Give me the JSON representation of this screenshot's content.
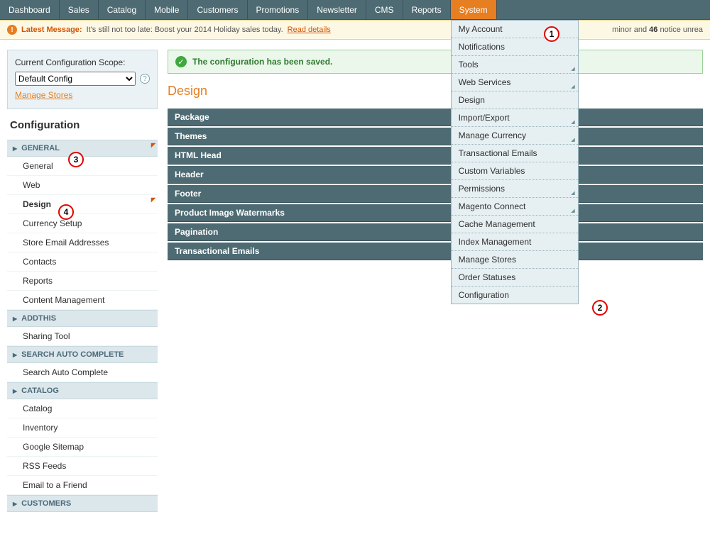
{
  "topnav": {
    "items": [
      {
        "label": "Dashboard"
      },
      {
        "label": "Sales"
      },
      {
        "label": "Catalog"
      },
      {
        "label": "Mobile"
      },
      {
        "label": "Customers"
      },
      {
        "label": "Promotions"
      },
      {
        "label": "Newsletter"
      },
      {
        "label": "CMS"
      },
      {
        "label": "Reports"
      },
      {
        "label": "System"
      }
    ],
    "dropdown": {
      "items": [
        {
          "label": "My Account",
          "expand": false
        },
        {
          "label": "Notifications",
          "expand": false
        },
        {
          "label": "Tools",
          "expand": true
        },
        {
          "label": "Web Services",
          "expand": true
        },
        {
          "label": "Design",
          "expand": false
        },
        {
          "label": "Import/Export",
          "expand": true
        },
        {
          "label": "Manage Currency",
          "expand": true
        },
        {
          "label": "Transactional Emails",
          "expand": false
        },
        {
          "label": "Custom Variables",
          "expand": false
        },
        {
          "label": "Permissions",
          "expand": true
        },
        {
          "label": "Magento Connect",
          "expand": true
        },
        {
          "label": "Cache Management",
          "expand": false
        },
        {
          "label": "Index Management",
          "expand": false
        },
        {
          "label": "Manage Stores",
          "expand": false
        },
        {
          "label": "Order Statuses",
          "expand": false
        },
        {
          "label": "Configuration",
          "expand": false
        }
      ]
    }
  },
  "msgbar": {
    "prefix": "Latest Message:",
    "text": "It's still not too late: Boost your 2014 Holiday sales today.",
    "link": "Read details",
    "right_minor": "minor and",
    "right_count": "46",
    "right_rest": "notice unrea"
  },
  "scope": {
    "label": "Current Configuration Scope:",
    "selected": "Default Config",
    "manage": "Manage Stores"
  },
  "conf_title": "Configuration",
  "sections": [
    {
      "head": "GENERAL",
      "marker": true,
      "items": [
        {
          "label": "General"
        },
        {
          "label": "Web"
        },
        {
          "label": "Design",
          "active": true,
          "marker": true
        },
        {
          "label": "Currency Setup"
        },
        {
          "label": "Store Email Addresses"
        },
        {
          "label": "Contacts"
        },
        {
          "label": "Reports"
        },
        {
          "label": "Content Management"
        }
      ]
    },
    {
      "head": "ADDTHIS",
      "items": [
        {
          "label": "Sharing Tool"
        }
      ]
    },
    {
      "head": "SEARCH AUTO COMPLETE",
      "items": [
        {
          "label": "Search Auto Complete"
        }
      ]
    },
    {
      "head": "CATALOG",
      "items": [
        {
          "label": "Catalog"
        },
        {
          "label": "Inventory"
        },
        {
          "label": "Google Sitemap"
        },
        {
          "label": "RSS Feeds"
        },
        {
          "label": "Email to a Friend"
        }
      ]
    },
    {
      "head": "CUSTOMERS",
      "items": []
    }
  ],
  "success_msg": "The configuration has been saved.",
  "page_title": "Design",
  "panels": [
    "Package",
    "Themes",
    "HTML Head",
    "Header",
    "Footer",
    "Product Image Watermarks",
    "Pagination",
    "Transactional Emails"
  ],
  "annotations": {
    "1": "1",
    "2": "2",
    "3": "3",
    "4": "4"
  }
}
